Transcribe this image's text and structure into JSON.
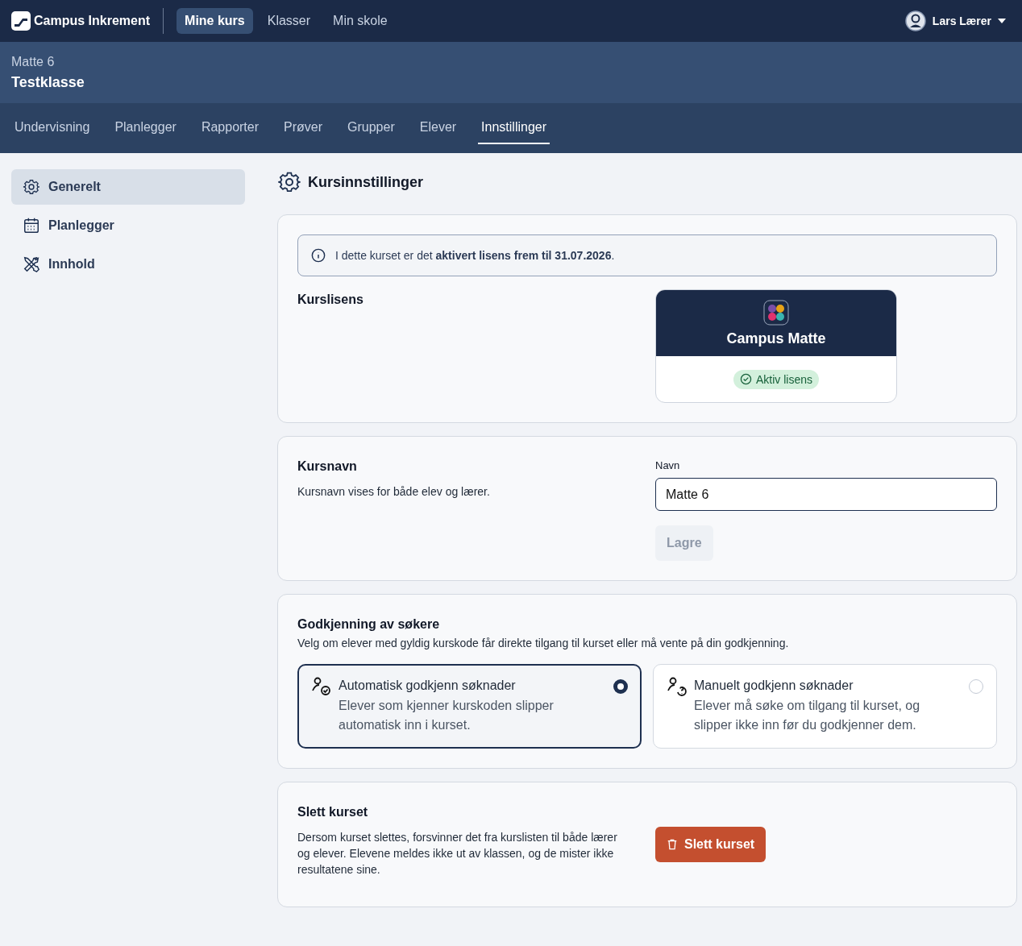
{
  "topbar": {
    "brand": "Campus Inkrement",
    "nav": [
      {
        "label": "Mine kurs",
        "selected": true
      },
      {
        "label": "Klasser",
        "selected": false
      },
      {
        "label": "Min skole",
        "selected": false
      }
    ],
    "user": "Lars Lærer"
  },
  "course": {
    "subtitle": "Matte 6",
    "title": "Testklasse"
  },
  "tabs": [
    {
      "label": "Undervisning",
      "selected": false
    },
    {
      "label": "Planlegger",
      "selected": false
    },
    {
      "label": "Rapporter",
      "selected": false
    },
    {
      "label": "Prøver",
      "selected": false
    },
    {
      "label": "Grupper",
      "selected": false
    },
    {
      "label": "Elever",
      "selected": false
    },
    {
      "label": "Innstillinger",
      "selected": true
    }
  ],
  "sidebar": {
    "items": [
      {
        "label": "Generelt",
        "kind": "settings",
        "selected": true
      },
      {
        "label": "Planlegger",
        "kind": "calendar",
        "selected": false
      },
      {
        "label": "Innhold",
        "kind": "tools",
        "selected": false
      }
    ]
  },
  "page_title": "Kursinnstillinger",
  "license": {
    "info": "I dette kurset er det **aktivert lisens frem til 31.07.2026**.",
    "heading": "Kurslisens",
    "product": "Campus Matte",
    "status": "Aktiv lisens"
  },
  "course_name": {
    "heading": "Kursnavn",
    "description": "Kursnavn vises for både elev og lærer.",
    "field_label": "Navn",
    "value": "Matte 6",
    "save": {
      "label": "Lagre",
      "disabled": true
    }
  },
  "approval": {
    "heading": "Godkjenning av søkere",
    "description": "Velg om elever med gyldig kurskode får direkte tilgang til kurset eller må vente på din godkjenning.",
    "options": [
      {
        "kind": "auto",
        "title": "Automatisk godkjenn søknader",
        "text": "Elever som kjenner kurskoden slipper automatisk inn i kurset.",
        "selected": true
      },
      {
        "kind": "manual",
        "title": "Manuelt godkjenn søknader",
        "text": "Elever må søke om tilgang til kurset, og slipper ikke inn før du godkjenner dem.",
        "selected": false
      }
    ]
  },
  "delete": {
    "heading": "Slett kurset",
    "description": "Dersom kurset slettes, forsvinner det fra kurslisten til både lærer og elever. Elevene meldes ikke ut av klassen, og de mister ikke resultatene sine.",
    "button": "Slett kurset"
  }
}
